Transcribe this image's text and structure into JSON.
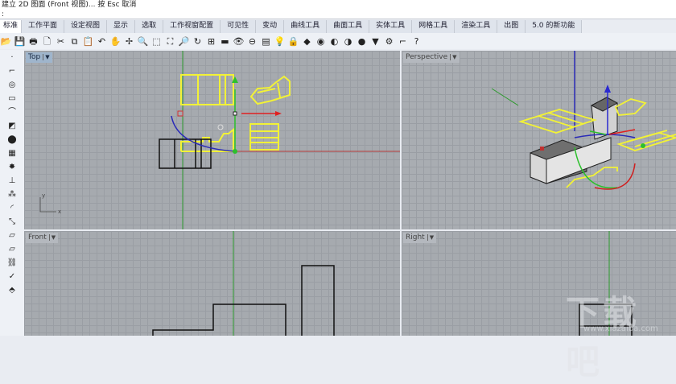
{
  "command_line": {
    "history": "建立 2D 图面 (Front 视图)... 按 Esc 取消",
    "prompt": ":"
  },
  "tabs": [
    "标准",
    "工作平面",
    "设定视图",
    "显示",
    "选取",
    "工作视窗配置",
    "可见性",
    "变动",
    "曲线工具",
    "曲面工具",
    "实体工具",
    "网格工具",
    "渲染工具",
    "出图",
    "5.0 的新功能"
  ],
  "toolbar": [
    {
      "icon": "open-icon",
      "g": "📂"
    },
    {
      "icon": "save-icon",
      "g": "💾"
    },
    {
      "icon": "print-icon",
      "g": "🖶"
    },
    {
      "icon": "import-icon",
      "g": "🗋"
    },
    {
      "icon": "cut-icon",
      "g": "✂"
    },
    {
      "icon": "copy-icon",
      "g": "⧉"
    },
    {
      "icon": "paste-icon",
      "g": "📋"
    },
    {
      "icon": "undo-icon",
      "g": "↶"
    },
    {
      "icon": "pan-icon",
      "g": "✋"
    },
    {
      "icon": "move-view-icon",
      "g": "✢"
    },
    {
      "icon": "zoom-icon",
      "g": "🔍"
    },
    {
      "icon": "zoom-window-icon",
      "g": "⬚"
    },
    {
      "icon": "zoom-extents-icon",
      "g": "⛶"
    },
    {
      "icon": "zoom-selected-icon",
      "g": "🔎"
    },
    {
      "icon": "rotate-view-icon",
      "g": "↻"
    },
    {
      "icon": "four-views-icon",
      "g": "⊞"
    },
    {
      "icon": "cplane-icon",
      "g": "▬"
    },
    {
      "icon": "hide-icon",
      "g": "👁"
    },
    {
      "icon": "named-view-icon",
      "g": "⊖"
    },
    {
      "icon": "layer-icon",
      "g": "▤"
    },
    {
      "icon": "light-icon",
      "g": "💡"
    },
    {
      "icon": "lock-icon",
      "g": "🔒"
    },
    {
      "icon": "material-icon",
      "g": "◆"
    },
    {
      "icon": "color-wheel-icon",
      "g": "◉"
    },
    {
      "icon": "shaded-icon",
      "g": "◐"
    },
    {
      "icon": "rendered-icon",
      "g": "◑"
    },
    {
      "icon": "render-icon",
      "g": "●"
    },
    {
      "icon": "options-icon",
      "g": "▼"
    },
    {
      "icon": "settings-icon",
      "g": "⚙"
    },
    {
      "icon": "snap-icon",
      "g": "⌐"
    },
    {
      "icon": "help-icon",
      "g": "?"
    }
  ],
  "sidebar": [
    {
      "icon": "point-icon",
      "g": "·"
    },
    {
      "icon": "polyline-icon",
      "g": "⌐"
    },
    {
      "icon": "circle-icon",
      "g": "◎"
    },
    {
      "icon": "rectangle-icon",
      "g": "▭"
    },
    {
      "icon": "curve-icon",
      "g": "⌒"
    },
    {
      "icon": "surface-icon",
      "g": "◩"
    },
    {
      "icon": "solid-icon",
      "g": "⬤"
    },
    {
      "icon": "mesh-icon",
      "g": "▦"
    },
    {
      "icon": "explode-icon",
      "g": "✸"
    },
    {
      "icon": "dimension-icon",
      "g": "⊥"
    },
    {
      "icon": "transform-icon",
      "g": "⁂"
    },
    {
      "icon": "fillet-icon",
      "g": "◜"
    },
    {
      "icon": "scale-icon",
      "g": "⤡"
    },
    {
      "icon": "array-icon",
      "g": "▱"
    },
    {
      "icon": "ruler-icon",
      "g": "⏥"
    },
    {
      "icon": "group-icon",
      "g": "⛓"
    },
    {
      "icon": "check-icon",
      "g": "✓"
    },
    {
      "icon": "paint-icon",
      "g": "⬘"
    }
  ],
  "viewports": {
    "top": "Top",
    "perspective": "Perspective",
    "front": "Front",
    "right": "Right"
  },
  "axes": {
    "x": "x",
    "y": "y"
  },
  "watermark": {
    "main": "下载吧",
    "url": "www.xiazaiba.com"
  },
  "colors": {
    "selected": "#f2f236",
    "x_axis": "#c03030",
    "y_axis": "#30a030",
    "z_axis": "#2020c0"
  }
}
